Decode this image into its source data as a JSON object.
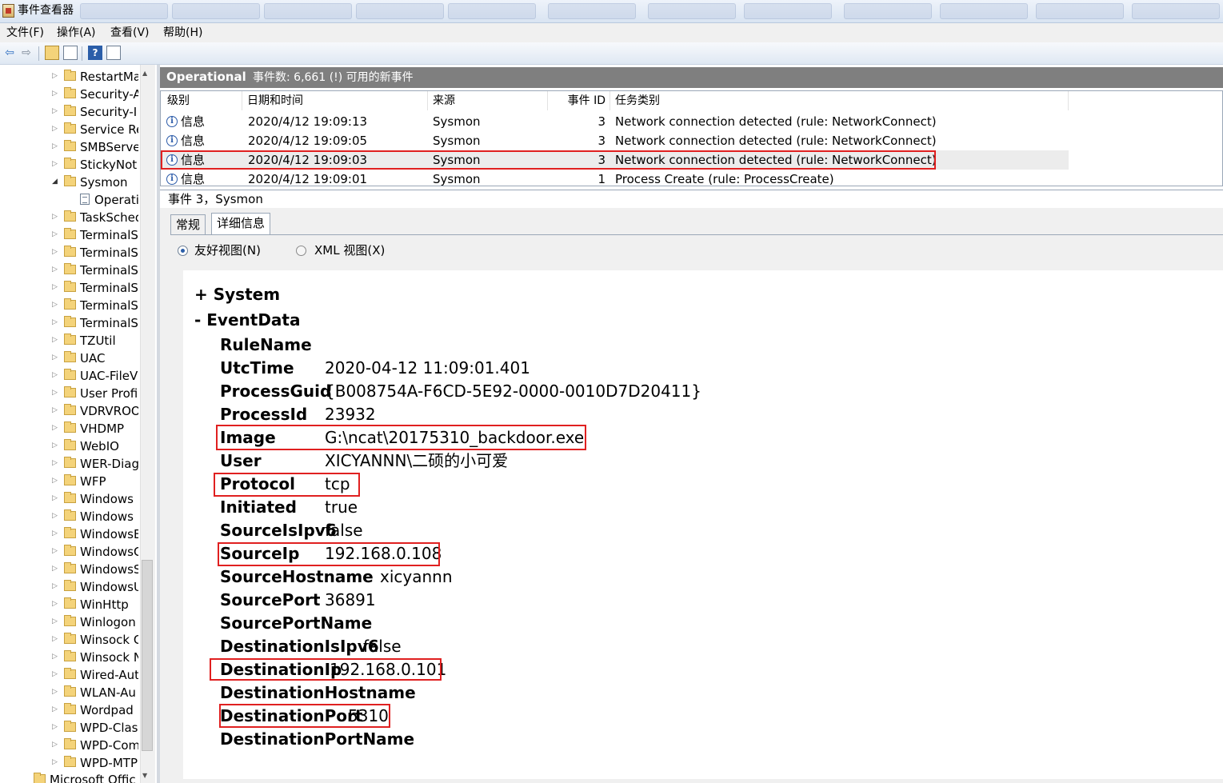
{
  "window": {
    "title": "事件查看器"
  },
  "menu": [
    "文件(F)",
    "操作(A)",
    "查看(V)",
    "帮助(H)"
  ],
  "toolbar": [
    "back-icon",
    "forward-icon",
    "folder-up-icon",
    "properties-icon",
    "help-icon",
    "pane-icon"
  ],
  "tree": {
    "items": [
      {
        "label": "RestartMa"
      },
      {
        "label": "Security-A"
      },
      {
        "label": "Security-I"
      },
      {
        "label": "Service Re"
      },
      {
        "label": "SMBServe"
      },
      {
        "label": "StickyNot"
      },
      {
        "label": "Sysmon",
        "expanded": true
      },
      {
        "label": "Operati",
        "child": true,
        "selected": true
      },
      {
        "label": "TaskSched"
      },
      {
        "label": "TerminalS"
      },
      {
        "label": "TerminalS"
      },
      {
        "label": "TerminalS"
      },
      {
        "label": "TerminalS"
      },
      {
        "label": "TerminalS"
      },
      {
        "label": "TerminalS"
      },
      {
        "label": "TZUtil"
      },
      {
        "label": "UAC"
      },
      {
        "label": "UAC-FileV"
      },
      {
        "label": "User Profi"
      },
      {
        "label": "VDRVROO"
      },
      {
        "label": "VHDMP"
      },
      {
        "label": "WebIO"
      },
      {
        "label": "WER-Diag"
      },
      {
        "label": "WFP"
      },
      {
        "label": "Windows"
      },
      {
        "label": "Windows"
      },
      {
        "label": "WindowsE"
      },
      {
        "label": "WindowsC"
      },
      {
        "label": "WindowsS"
      },
      {
        "label": "WindowsU"
      },
      {
        "label": "WinHttp"
      },
      {
        "label": "Winlogon"
      },
      {
        "label": "Winsock C"
      },
      {
        "label": "Winsock N"
      },
      {
        "label": "Wired-Aut"
      },
      {
        "label": "WLAN-Au"
      },
      {
        "label": "Wordpad"
      },
      {
        "label": "WPD-Class"
      },
      {
        "label": "WPD-Com"
      },
      {
        "label": "WPD-MTP"
      }
    ],
    "bottom_label": "Microsoft Offic"
  },
  "log_header": {
    "title": "Operational",
    "count_text": "事件数: 6,661 (!) 可用的新事件"
  },
  "events": {
    "columns": [
      "级别",
      "日期和时间",
      "来源",
      "事件 ID",
      "任务类别"
    ],
    "rows": [
      {
        "level": "信息",
        "datetime": "2020/4/12 19:09:13",
        "source": "Sysmon",
        "id": "3",
        "task": "Network connection detected (rule: NetworkConnect)"
      },
      {
        "level": "信息",
        "datetime": "2020/4/12 19:09:05",
        "source": "Sysmon",
        "id": "3",
        "task": "Network connection detected (rule: NetworkConnect)"
      },
      {
        "level": "信息",
        "datetime": "2020/4/12 19:09:03",
        "source": "Sysmon",
        "id": "3",
        "task": "Network connection detected (rule: NetworkConnect)",
        "selected": true
      },
      {
        "level": "信息",
        "datetime": "2020/4/12 19:09:01",
        "source": "Sysmon",
        "id": "1",
        "task": "Process Create (rule: ProcessCreate)"
      }
    ]
  },
  "detail": {
    "title": "事件 3，Sysmon",
    "tabs": [
      "常规",
      "详细信息"
    ],
    "active_tab": "详细信息",
    "radio_friendly": "友好视图(N)",
    "radio_xml": "XML 视图(X)",
    "system_label": "+ System",
    "eventdata_label": "-  EventData",
    "fields": [
      {
        "name": "RuleName",
        "value": ""
      },
      {
        "name": "UtcTime",
        "value": "2020-04-12 11:09:01.401"
      },
      {
        "name": "ProcessGuid",
        "value": "{B008754A-F6CD-5E92-0000-0010D7D20411}"
      },
      {
        "name": "ProcessId",
        "value": "23932"
      },
      {
        "name": "Image",
        "value": "G:\\ncat\\20175310_backdoor.exe",
        "highlight": true
      },
      {
        "name": "User",
        "value": "XICYANNN\\二硕的小可爱"
      },
      {
        "name": "Protocol",
        "value": "tcp",
        "highlight": true
      },
      {
        "name": "Initiated",
        "value": "true"
      },
      {
        "name": "SourceIsIpv6",
        "value": "false"
      },
      {
        "name": "SourceIp",
        "value": "192.168.0.108",
        "highlight": true
      },
      {
        "name": "SourceHostname",
        "value": "xicyannn"
      },
      {
        "name": "SourcePort",
        "value": "36891"
      },
      {
        "name": "SourcePortName",
        "value": ""
      },
      {
        "name": "DestinationIsIpv6",
        "value": "false"
      },
      {
        "name": "DestinationIp",
        "value": "192.168.0.101",
        "highlight": true
      },
      {
        "name": "DestinationHostname",
        "value": ""
      },
      {
        "name": "DestinationPort",
        "value": "5310",
        "highlight": true
      },
      {
        "name": "DestinationPortName",
        "value": ""
      }
    ]
  },
  "colors": {
    "highlight_border": "#e02020",
    "header_bg": "#7f7f7f",
    "selected_row": "#ececec"
  }
}
